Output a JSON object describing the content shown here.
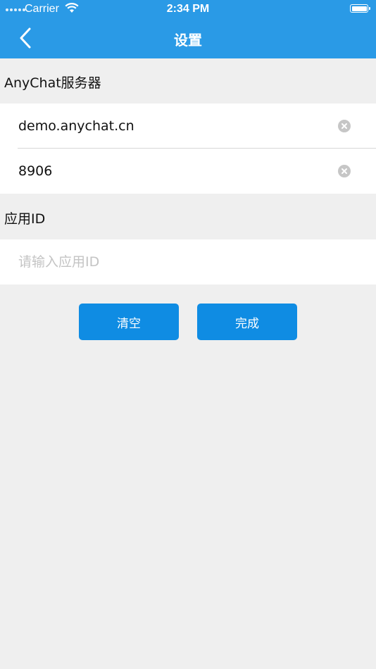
{
  "status_bar": {
    "carrier": "Carrier",
    "time": "2:34 PM"
  },
  "nav": {
    "title": "设置"
  },
  "server_section": {
    "label": "AnyChat服务器",
    "address_value": "demo.anychat.cn",
    "port_value": "8906"
  },
  "app_section": {
    "label": "应用ID",
    "app_id_placeholder": "请输入应用ID",
    "app_id_value": ""
  },
  "buttons": {
    "clear_label": "清空",
    "done_label": "完成"
  },
  "colors": {
    "nav_bar": "#2a9ae6",
    "button": "#0f8ce3",
    "background": "#efefef"
  }
}
